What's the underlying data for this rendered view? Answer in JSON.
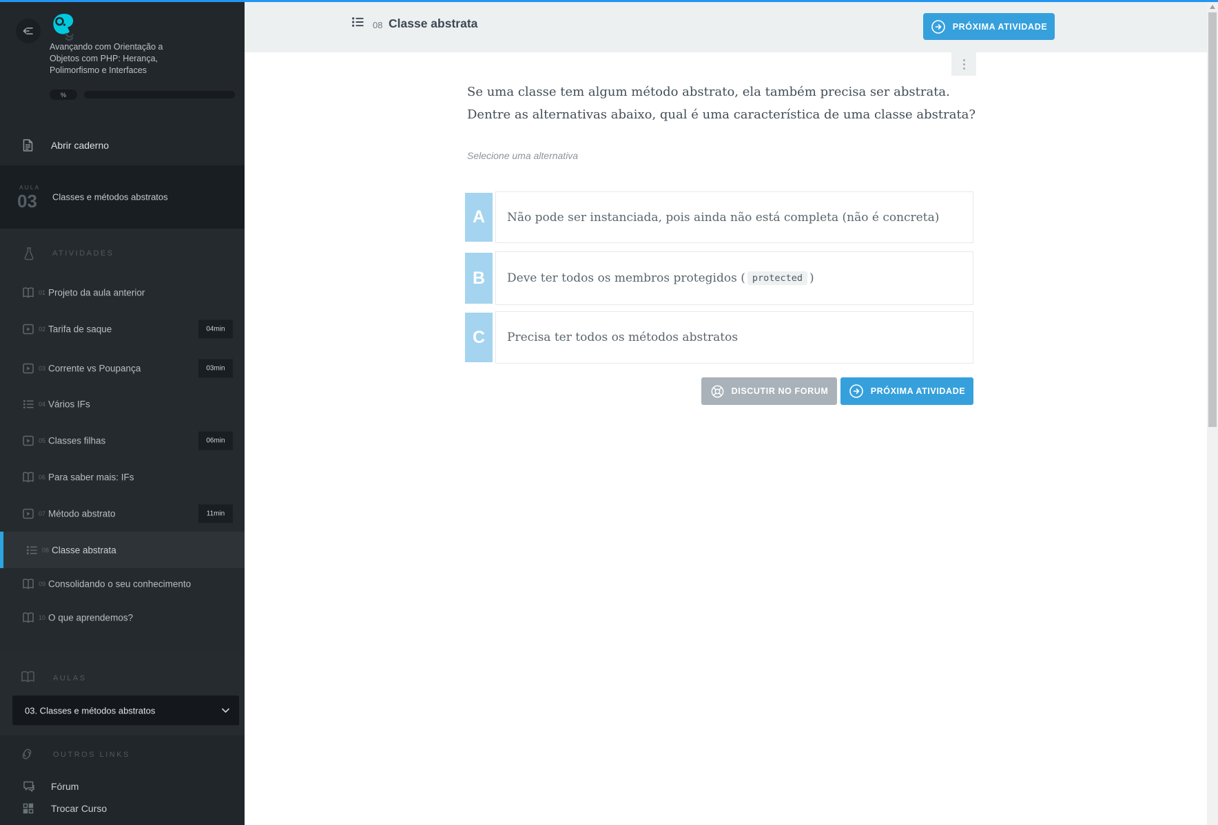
{
  "colors": {
    "topline": "#2196f3",
    "accent_blue": "#36a0dc",
    "letter_bg": "#a4d4ef",
    "sidebar_active_bar": "#2ca6e0"
  },
  "sidebar": {
    "course_title": "Avançando com Orientação a Objetos com PHP: Herança, Polimorfismo e Interfaces",
    "progress_label": "%",
    "notebook_label": "Abrir caderno",
    "aula": {
      "eyebrow": "AULA",
      "number": "03",
      "title": "Classes e métodos abstratos"
    },
    "activities_header": "ATIVIDADES",
    "activities": [
      {
        "num": "01",
        "label": "Projeto da aula anterior",
        "icon": "book-icon"
      },
      {
        "num": "02",
        "label": "Tarifa de saque",
        "icon": "video-icon",
        "duration": "04min"
      },
      {
        "num": "03",
        "label": "Corrente vs Poupança",
        "icon": "video-icon",
        "duration": "03min"
      },
      {
        "num": "04",
        "label": "Vários IFs",
        "icon": "quiz-list-icon"
      },
      {
        "num": "05",
        "label": "Classes filhas",
        "icon": "video-icon",
        "duration": "06min"
      },
      {
        "num": "06",
        "label": "Para saber mais: IFs",
        "icon": "book-icon"
      },
      {
        "num": "07",
        "label": "Método abstrato",
        "icon": "video-icon",
        "duration": "11min"
      },
      {
        "num": "08",
        "label": "Classe abstrata",
        "icon": "quiz-list-icon",
        "active": true
      },
      {
        "num": "09",
        "label": "Consolidando o seu conhecimento",
        "icon": "book-icon"
      },
      {
        "num": "10",
        "label": "O que aprendemos?",
        "icon": "book-icon"
      }
    ],
    "aulas_header": "AULAS",
    "aulas_selected": "03. Classes e métodos abstratos",
    "outros_header": "OUTROS LINKS",
    "forum_label": "Fórum",
    "trocar_label": "Trocar Curso"
  },
  "header": {
    "number": "08",
    "title": "Classe abstrata",
    "next_button": "PRÓXIMA ATIVIDADE"
  },
  "question": {
    "line1": "Se uma classe tem algum método abstrato, ela também precisa ser abstrata.",
    "line2": "Dentre as alternativas abaixo, qual é uma característica de uma classe abstrata?",
    "hint": "Selecione uma alternativa"
  },
  "alternatives": [
    {
      "letter": "A",
      "text": "Não pode ser instanciada, pois ainda não está completa (não é concreta)"
    },
    {
      "letter": "B",
      "text_before": "Deve ter todos os membros protegidos (",
      "code": "protected",
      "text_after": ")"
    },
    {
      "letter": "C",
      "text": "Precisa ter todos os métodos abstratos"
    }
  ],
  "actions": {
    "forum_button": "DISCUTIR NO FORUM",
    "next_button": "PRÓXIMA ATIVIDADE"
  }
}
